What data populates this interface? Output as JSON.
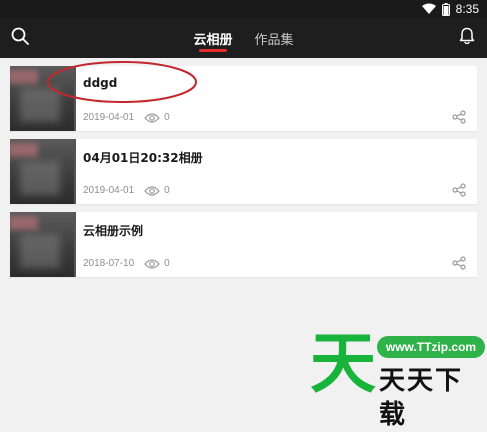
{
  "status_bar": {
    "time": "8:35",
    "icons": [
      "wifi-icon",
      "battery-icon"
    ]
  },
  "app_bar": {
    "tabs": [
      {
        "label": "云相册",
        "active": true
      },
      {
        "label": "作品集",
        "active": false
      }
    ],
    "left_icon": "search-icon",
    "right_icon": "bell-icon",
    "accent_color": "#e52b2b"
  },
  "albums": [
    {
      "title": "ddgd",
      "date": "2019-04-01",
      "views": "0"
    },
    {
      "title": "04月01日20:32相册",
      "date": "2019-04-01",
      "views": "0"
    },
    {
      "title": "云相册示例",
      "date": "2018-07-10",
      "views": "0"
    }
  ],
  "annotation": {
    "color": "#c0282d"
  },
  "watermark": {
    "glyph": "天",
    "url": "www.TTzip.com",
    "text": "天天下载",
    "brand_color": "#17b33a"
  }
}
